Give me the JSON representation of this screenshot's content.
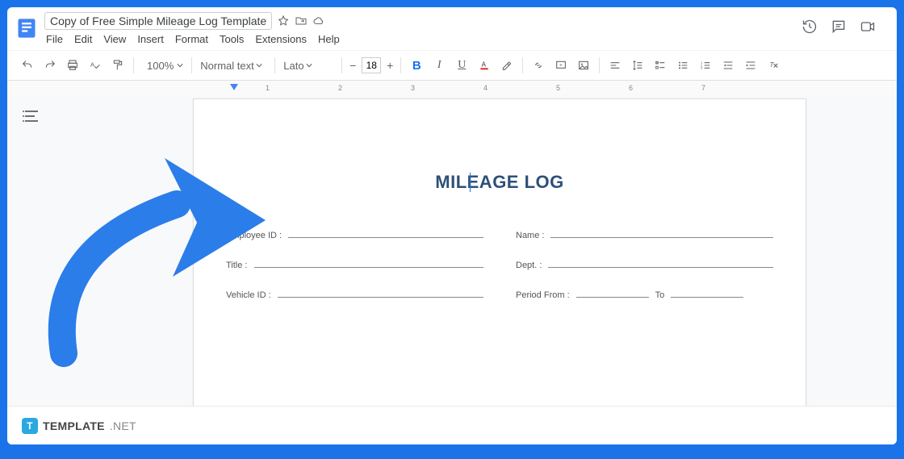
{
  "header": {
    "doc_title": "Copy of Free Simple Mileage Log Template",
    "menus": [
      "File",
      "Edit",
      "View",
      "Insert",
      "Format",
      "Tools",
      "Extensions",
      "Help"
    ]
  },
  "toolbar": {
    "zoom": "100%",
    "style": "Normal text",
    "font": "Lato",
    "font_size": "18"
  },
  "ruler": {
    "ticks": [
      "1",
      "2",
      "3",
      "4",
      "5",
      "6",
      "7"
    ]
  },
  "document": {
    "heading": "MILEAGE LOG",
    "fields": {
      "employee_id": "Employee ID :",
      "name": "Name :",
      "title": "Title :",
      "dept": "Dept. :",
      "vehicle_id": "Vehicle ID :",
      "period_from": "Period From :",
      "to": "To"
    }
  },
  "footer": {
    "brand": "TEMPLATE",
    "suffix": ".NET"
  }
}
